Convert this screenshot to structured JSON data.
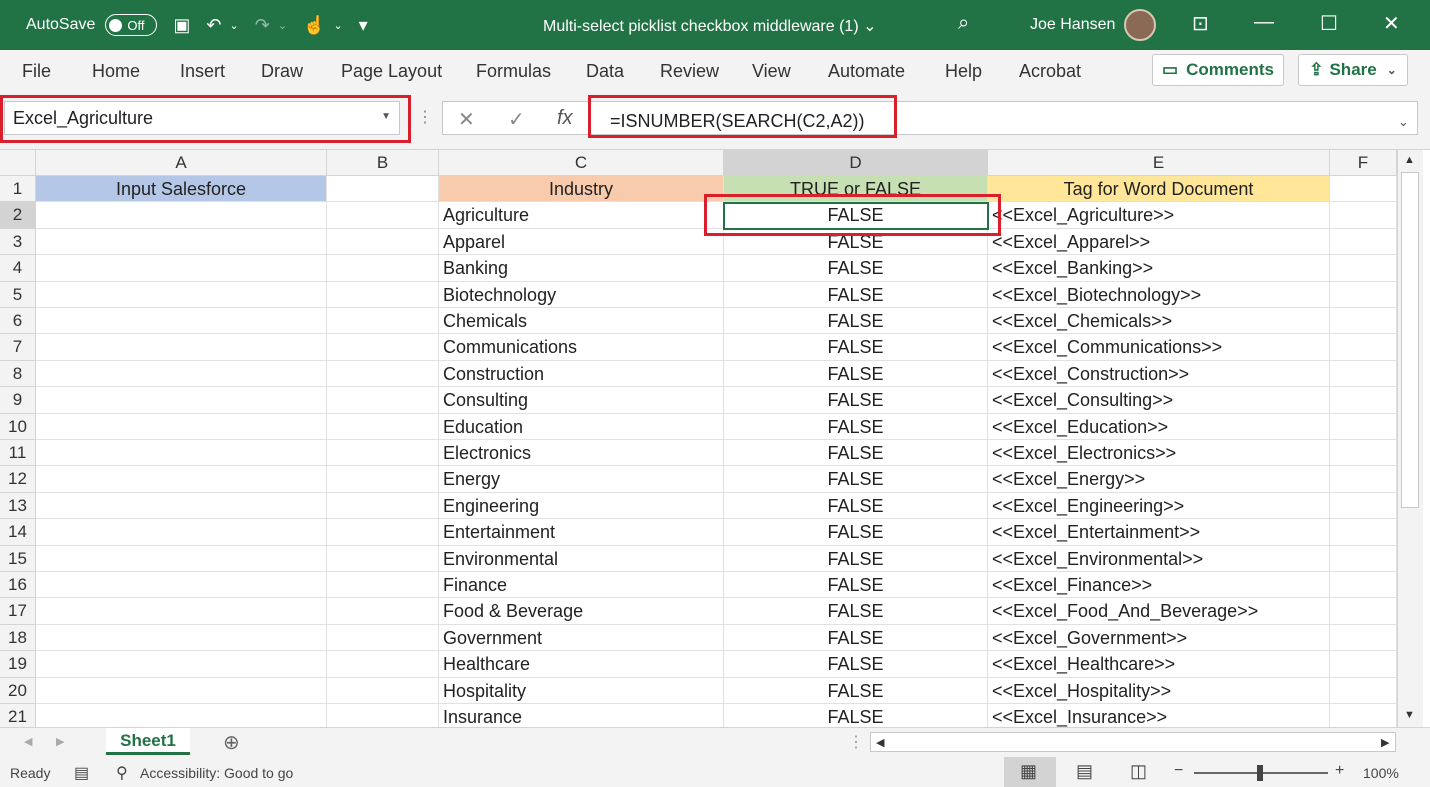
{
  "titlebar": {
    "autosave_label": "AutoSave",
    "autosave_state": "Off",
    "document_title": "Multi-select picklist checkbox middleware (1) ⌄",
    "user_name": "Joe Hansen"
  },
  "menu": [
    "File",
    "Home",
    "Insert",
    "Draw",
    "Page Layout",
    "Formulas",
    "Data",
    "Review",
    "View",
    "Automate",
    "Help",
    "Acrobat"
  ],
  "actions": {
    "comments": "Comments",
    "share": "Share"
  },
  "formula_bar": {
    "name_box": "Excel_Agriculture",
    "formula": "=ISNUMBER(SEARCH(C2,A2))"
  },
  "columns": [
    "A",
    "B",
    "C",
    "D",
    "E",
    "F"
  ],
  "headers_row": {
    "row_num": "1",
    "a": "Input Salesforce",
    "c": "Industry",
    "d": "TRUE or FALSE",
    "e": "Tag for Word Document"
  },
  "rows": [
    {
      "n": "2",
      "industry": "Agriculture",
      "value": "FALSE",
      "tag": "<<Excel_Agriculture>>"
    },
    {
      "n": "3",
      "industry": "Apparel",
      "value": "FALSE",
      "tag": "<<Excel_Apparel>>"
    },
    {
      "n": "4",
      "industry": "Banking",
      "value": "FALSE",
      "tag": "<<Excel_Banking>>"
    },
    {
      "n": "5",
      "industry": "Biotechnology",
      "value": "FALSE",
      "tag": "<<Excel_Biotechnology>>"
    },
    {
      "n": "6",
      "industry": "Chemicals",
      "value": "FALSE",
      "tag": "<<Excel_Chemicals>>"
    },
    {
      "n": "7",
      "industry": "Communications",
      "value": "FALSE",
      "tag": "<<Excel_Communications>>"
    },
    {
      "n": "8",
      "industry": "Construction",
      "value": "FALSE",
      "tag": "<<Excel_Construction>>"
    },
    {
      "n": "9",
      "industry": "Consulting",
      "value": "FALSE",
      "tag": "<<Excel_Consulting>>"
    },
    {
      "n": "10",
      "industry": "Education",
      "value": "FALSE",
      "tag": "<<Excel_Education>>"
    },
    {
      "n": "11",
      "industry": "Electronics",
      "value": "FALSE",
      "tag": "<<Excel_Electronics>>"
    },
    {
      "n": "12",
      "industry": "Energy",
      "value": "FALSE",
      "tag": "<<Excel_Energy>>"
    },
    {
      "n": "13",
      "industry": "Engineering",
      "value": "FALSE",
      "tag": "<<Excel_Engineering>>"
    },
    {
      "n": "14",
      "industry": "Entertainment",
      "value": "FALSE",
      "tag": "<<Excel_Entertainment>>"
    },
    {
      "n": "15",
      "industry": "Environmental",
      "value": "FALSE",
      "tag": "<<Excel_Environmental>>"
    },
    {
      "n": "16",
      "industry": "Finance",
      "value": "FALSE",
      "tag": "<<Excel_Finance>>"
    },
    {
      "n": "17",
      "industry": "Food & Beverage",
      "value": "FALSE",
      "tag": "<<Excel_Food_And_Beverage>>"
    },
    {
      "n": "18",
      "industry": "Government",
      "value": "FALSE",
      "tag": "<<Excel_Government>>"
    },
    {
      "n": "19",
      "industry": "Healthcare",
      "value": "FALSE",
      "tag": "<<Excel_Healthcare>>"
    },
    {
      "n": "20",
      "industry": "Hospitality",
      "value": "FALSE",
      "tag": "<<Excel_Hospitality>>"
    },
    {
      "n": "21",
      "industry": "Insurance",
      "value": "FALSE",
      "tag": "<<Excel_Insurance>>"
    }
  ],
  "sheet_tab": "Sheet1",
  "status": {
    "ready": "Ready",
    "accessibility": "Accessibility: Good to go",
    "zoom": "100%"
  },
  "colors": {
    "excel_green": "#217346",
    "header_blue": "#b4c7e7",
    "header_orange": "#f8cbad",
    "header_green": "#c6e0b4",
    "header_yellow": "#ffe699",
    "highlight_red": "#d9202a"
  }
}
